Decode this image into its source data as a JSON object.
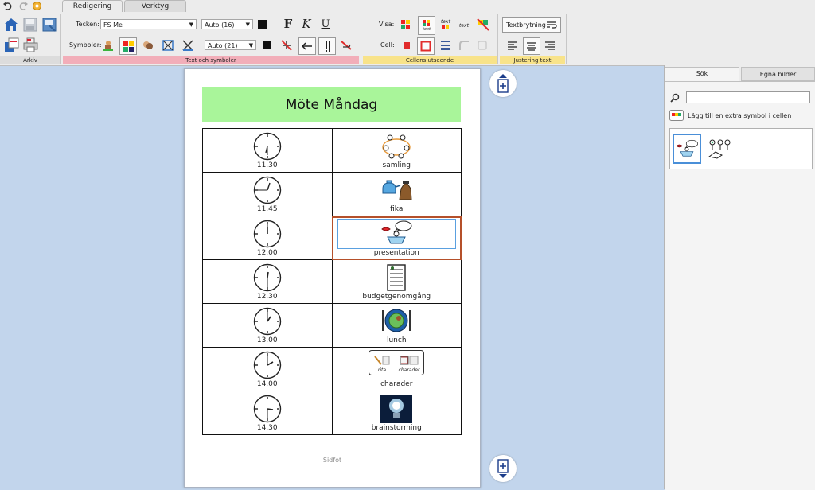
{
  "ribbon": {
    "tabs": [
      "Redigering",
      "Verktyg"
    ],
    "arkiv_label": "Arkiv",
    "text_group_label": "Text och symboler",
    "cell_group_label": "Cellens utseende",
    "justify_group_label": "Justering text",
    "tecken_label": "Tecken:",
    "font_value": "FS Me",
    "font_size_value": "Auto (16)",
    "symboler_label": "Symboler:",
    "symbol_size_value": "Auto (21)",
    "visa_label": "Visa:",
    "cell_label": "Cell:",
    "textbrytning_label": "Textbrytning",
    "bold_glyph": "F",
    "italic_glyph": "K",
    "underline_glyph": "U",
    "text_label_small": "text",
    "colors": {
      "group_pink": "#f2aeb9",
      "group_yellow": "#f8e38a",
      "accent_red": "#e12b2b"
    }
  },
  "document": {
    "title": "Möte Måndag",
    "footer": "Sidfot",
    "rows": [
      {
        "time": "11.30",
        "label": "samling"
      },
      {
        "time": "11.45",
        "label": "fika"
      },
      {
        "time": "12.00",
        "label": "presentation"
      },
      {
        "time": "12.30",
        "label": "budgetgenomgång"
      },
      {
        "time": "13.00",
        "label": "lunch"
      },
      {
        "time": "14.00",
        "label": "charader"
      },
      {
        "time": "14.30",
        "label": "brainstorming"
      }
    ],
    "charader_subs": [
      "rita",
      "charader"
    ],
    "title_bg": "#a9f59a"
  },
  "sidebar": {
    "tabs": [
      "Sök",
      "Egna bilder"
    ],
    "search_value": "",
    "add_symbol_text": "Lägg till en extra symbol i cellen"
  }
}
